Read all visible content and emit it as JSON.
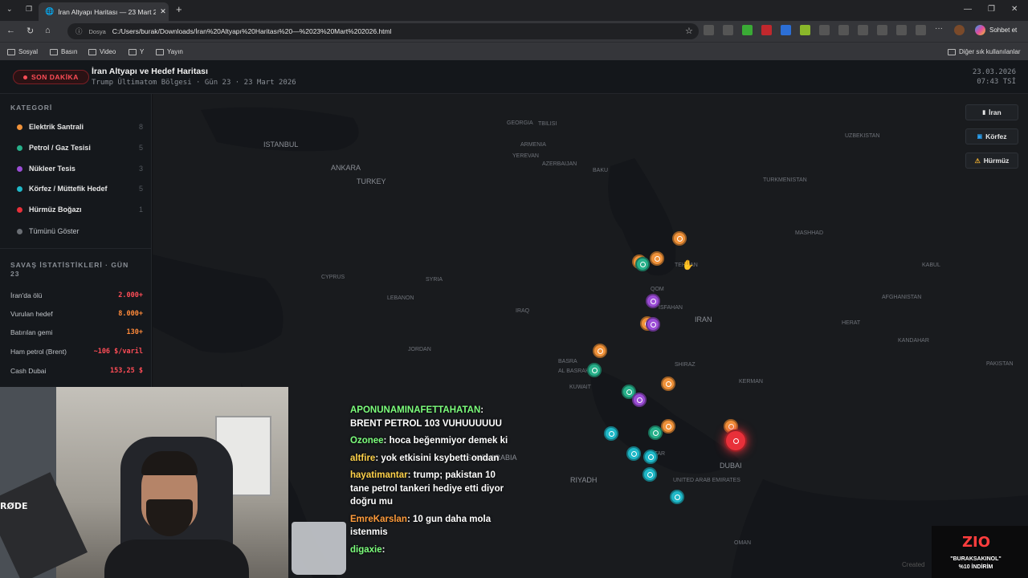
{
  "browser": {
    "tab_title": "İran Altyapı Haritası — 23 Mart 2026",
    "url_label": "Dosya",
    "url": "C:/Users/burak/Downloads/İran%20Altyapı%20Haritası%20—%2023%20Mart%202026.html",
    "copilot_label": "Sohbet et",
    "bookmarks": [
      "Sosyal",
      "Basın",
      "Video",
      "Y",
      "Yayın"
    ],
    "other_bookmarks": "Diğer sık kullanılanlar"
  },
  "header": {
    "badge": "SON DAKİKA",
    "title": "İran Altyapı ve Hedef Haritası",
    "subtitle": "Trump Ültimatom Bölgesi · Gün 23 · 23 Mart 2026",
    "date": "23.03.2026",
    "time": "07:43 TSİ"
  },
  "sidebar": {
    "category_heading": "KATEGORİ",
    "categories": [
      {
        "label": "Elektrik Santrali",
        "count": "8",
        "color": "#f0923a"
      },
      {
        "label": "Petrol / Gaz Tesisi",
        "count": "5",
        "color": "#27b08a"
      },
      {
        "label": "Nükleer Tesis",
        "count": "3",
        "color": "#9b4dd6"
      },
      {
        "label": "Körfez / Müttefik Hedef",
        "count": "5",
        "color": "#1fb8c8"
      },
      {
        "label": "Hürmüz Boğazı",
        "count": "1",
        "color": "#e8303a"
      }
    ],
    "show_all": "Tümünü Göster",
    "stats_heading": "SAVAŞ İSTATİSTİKLERİ · GÜN 23",
    "stats": [
      {
        "label": "İran'da ölü",
        "value": "2.000+"
      },
      {
        "label": "Vurulan hedef",
        "value": "8.000+"
      },
      {
        "label": "Batırılan gemi",
        "value": "130+"
      },
      {
        "label": "Ham petrol (Brent)",
        "value": "~106 $/varil"
      },
      {
        "label": "Cash Dubai",
        "value": "153,25 $"
      }
    ]
  },
  "map_buttons": [
    "İran",
    "Körfez",
    "Hürmüz"
  ],
  "map_labels": {
    "countries": [
      "TURKEY",
      "SYRIA",
      "IRAQ",
      "IRAN",
      "JORDAN",
      "KUWAIT",
      "SAUDI ARABIA",
      "AFGHANISTAN",
      "PAKISTAN",
      "TURKMENISTAN",
      "UZBEKISTAN",
      "GEORGIA",
      "ARMENIA",
      "AZERBAIJAN",
      "LEBANON",
      "CYPRUS",
      "OMAN",
      "UNITED ARAB EMIRATES",
      "QATAR"
    ],
    "cities": [
      "ISTANBUL",
      "ANKARA",
      "TEHRAN",
      "RIYADH",
      "DUBAI",
      "BAKU",
      "TBILISI",
      "YEREVAN",
      "KABUL",
      "KANDAHAR",
      "HERAT",
      "MASHHAD",
      "QOM",
      "ISFAHAN",
      "SHIRAZ",
      "KERMAN",
      "BASRA",
      "AL BASRAH"
    ]
  },
  "chat": [
    {
      "user": "APONUNAMINAFETTAHATAN",
      "text": "BRENT PETROL 103 VUHUUUUUU"
    },
    {
      "user": "Ozonee",
      "text": "hoca beğenmiyor demek ki"
    },
    {
      "user": "altfire",
      "text": "yok etkisini ksybetti ondan"
    },
    {
      "user": "hayatimantar",
      "text": "trump; pakistan 10 tane petrol tankeri hediye etti diyor doğru mu"
    },
    {
      "user": "EmreKarslan",
      "text": "10 gun daha mola istenmis"
    },
    {
      "user": "digaxie",
      "text": ""
    }
  ],
  "overlay": {
    "zio_logo": "ZIO",
    "zio_line1": "\"BURAKSAKINOL\"",
    "zio_line2": "%10 İNDİRİM",
    "created": "Created"
  }
}
